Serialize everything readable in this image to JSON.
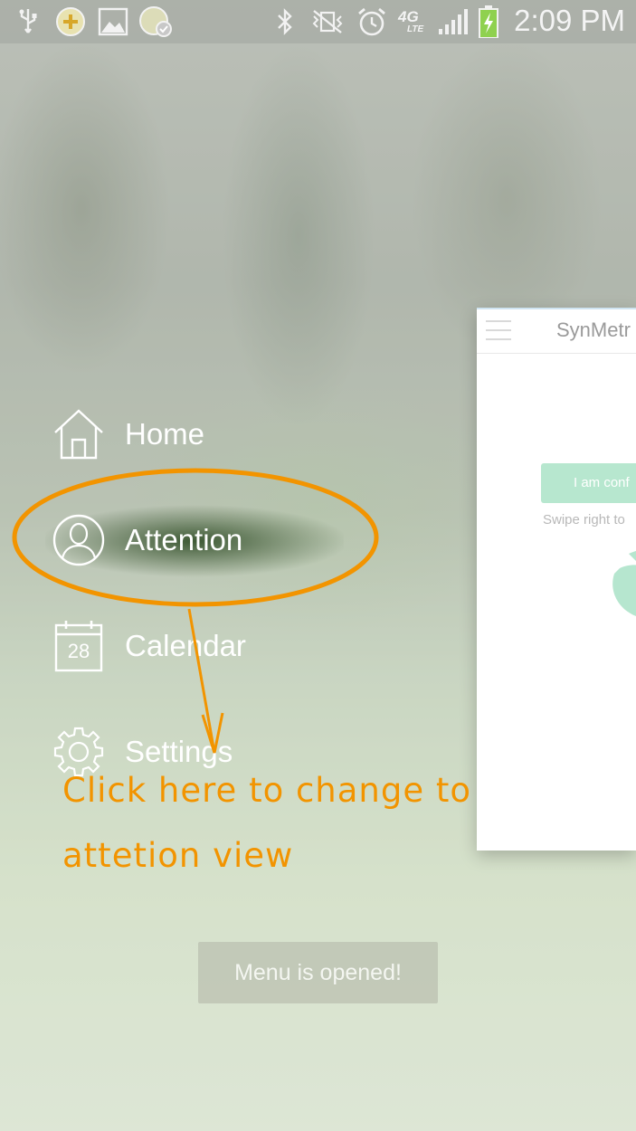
{
  "status_bar": {
    "time": "2:09 PM",
    "network": "4G",
    "network_sub": "LTE",
    "icons": [
      "usb-icon",
      "app-notification-icon",
      "gallery-icon",
      "app-sync-icon",
      "bluetooth-icon",
      "vibrate-mute-icon",
      "alarm-icon",
      "signal-icon",
      "battery-charging-icon"
    ]
  },
  "app_preview": {
    "title": "SynMetr",
    "button_label": "I am conf",
    "hint": "Swipe right to"
  },
  "menu": {
    "items": [
      {
        "label": "Home",
        "icon": "home-icon"
      },
      {
        "label": "Attention",
        "icon": "person-icon"
      },
      {
        "label": "Calendar",
        "icon": "calendar-icon",
        "badge": "28"
      },
      {
        "label": "Settings",
        "icon": "gear-icon"
      }
    ]
  },
  "annotation": {
    "line1": "Click here to change to",
    "line2": "attetion view",
    "color": "#f29400"
  },
  "toast": {
    "text": "Menu is opened!"
  }
}
